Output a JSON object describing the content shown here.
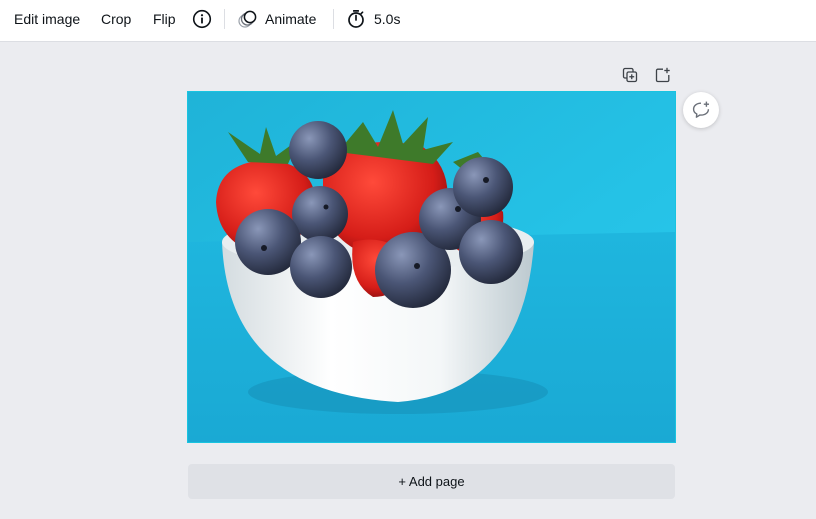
{
  "toolbar": {
    "edit_image_label": "Edit image",
    "crop_label": "Crop",
    "flip_label": "Flip",
    "info_icon": "info-icon",
    "animate_icon": "animate-icon",
    "animate_label": "Animate",
    "timer_icon": "stopwatch-icon",
    "duration_label": "5.0s"
  },
  "page_tools": {
    "duplicate_icon": "duplicate-page-icon",
    "add_icon": "add-page-icon"
  },
  "comment": {
    "icon": "add-comment-icon"
  },
  "canvas": {
    "image": "strawberries-and-blueberries-in-white-bowl-photo"
  },
  "footer": {
    "add_page_label": "+ Add page"
  },
  "colors": {
    "accent_border": "#19c4e0",
    "background": "#ebecf0",
    "toolbar_bg": "#ffffff",
    "photo_background": "#23bfe2"
  }
}
